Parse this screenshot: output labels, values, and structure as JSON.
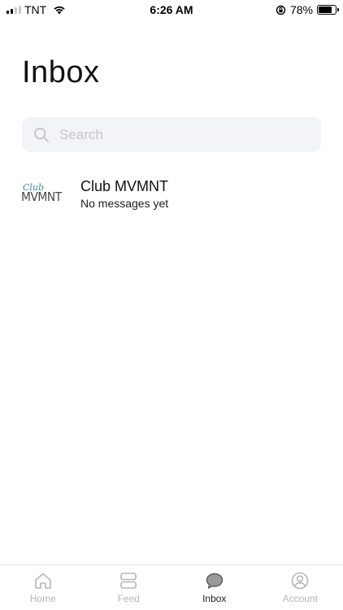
{
  "status_bar": {
    "carrier": "TNT",
    "time": "6:26 AM",
    "battery_percent": "78%",
    "battery_level": 0.78,
    "icons": [
      "signal-icon",
      "wifi-icon",
      "orientation-lock-icon",
      "battery-icon"
    ]
  },
  "page": {
    "title": "Inbox"
  },
  "search": {
    "placeholder": "Search",
    "value": ""
  },
  "conversations": [
    {
      "name": "Club MVMNT",
      "preview": "No messages yet",
      "avatar_logo_script": "Club",
      "avatar_logo_word": "MVMNT"
    }
  ],
  "tab_bar": {
    "tabs": [
      {
        "label": "Home",
        "icon": "home-icon",
        "active": false
      },
      {
        "label": "Feed",
        "icon": "feed-icon",
        "active": false
      },
      {
        "label": "Inbox",
        "icon": "inbox-icon",
        "active": true
      },
      {
        "label": "Account",
        "icon": "account-icon",
        "active": false
      }
    ]
  },
  "colors": {
    "active_tab": "#222222",
    "inactive_tab": "#b5b5b5",
    "search_bg": "#f3f4f7",
    "logo_script": "#3d8fa3"
  }
}
